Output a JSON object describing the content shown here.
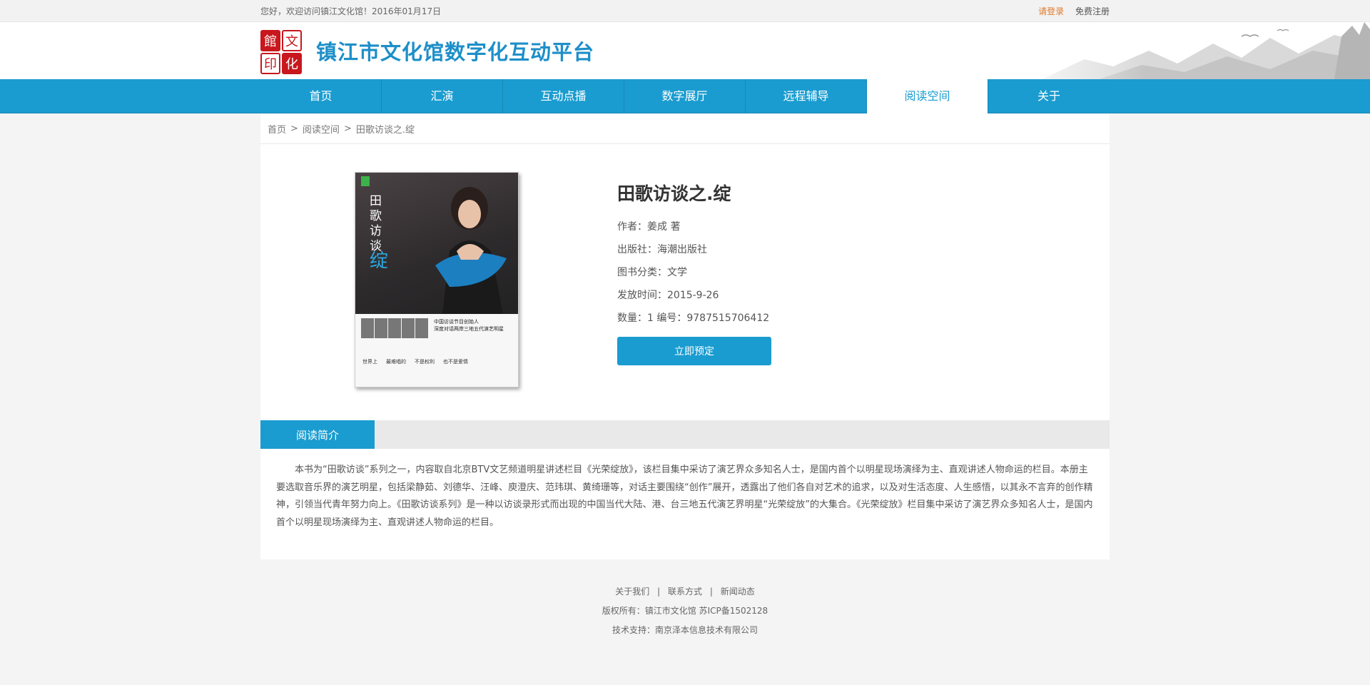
{
  "topbar": {
    "welcome": "您好，欢迎访问镇江文化馆！2016年01月17日",
    "login": "请登录",
    "register": "免费注册"
  },
  "header": {
    "logo_chars": [
      "館",
      "文",
      "印",
      "化"
    ],
    "site_title": "镇江市文化馆数字化互动平台"
  },
  "nav": {
    "items": [
      "首页",
      "汇演",
      "互动点播",
      "数字展厅",
      "远程辅导",
      "阅读空间",
      "关于"
    ],
    "active": "阅读空间"
  },
  "breadcrumb": {
    "home": "首页",
    "section": "阅读空间",
    "current": "田歌访谈之.绽",
    "sep": ">"
  },
  "book": {
    "title": "田歌访谈之.绽",
    "author": "作者：姜成  著",
    "publisher": "出版社：海潮出版社",
    "category": "图书分类：文学",
    "release": "发放时间：2015-9-26",
    "quantity_isbn": "数量：1    编号：9787515706412",
    "reserve_label": "立即预定"
  },
  "intro": {
    "tab": "阅读简介",
    "text": "本书为“田歌访谈”系列之一，内容取自北京BTV文艺频道明星讲述栏目《光荣绽放》，该栏目集中采访了演艺界众多知名人士，是国内首个以明星现场演绎为主、直观讲述人物命运的栏目。本册主要选取音乐界的演艺明星，包括梁静茹、刘德华、汪峰、庾澄庆、范玮琪、黄绮珊等，对话主要围绕“创作”展开，透露出了他们各自对艺术的追求，以及对生活态度、人生感悟，以其永不言弃的创作精神，引领当代青年努力向上。《田歌访谈系列》是一种以访谈录形式而出现的中国当代大陆、港、台三地五代演艺界明星“光荣绽放”的大集合。《光荣绽放》栏目集中采访了演艺界众多知名人士，是国内首个以明星现场演绎为主、直观讲述人物命运的栏目。"
  },
  "footer": {
    "links": [
      "关于我们",
      "联系方式",
      "新闻动态"
    ],
    "link_sep": "|",
    "copyright": "版权所有：镇江市文化馆 苏ICP备1502128",
    "support": "技术支持：南京泽本信息技术有限公司"
  }
}
